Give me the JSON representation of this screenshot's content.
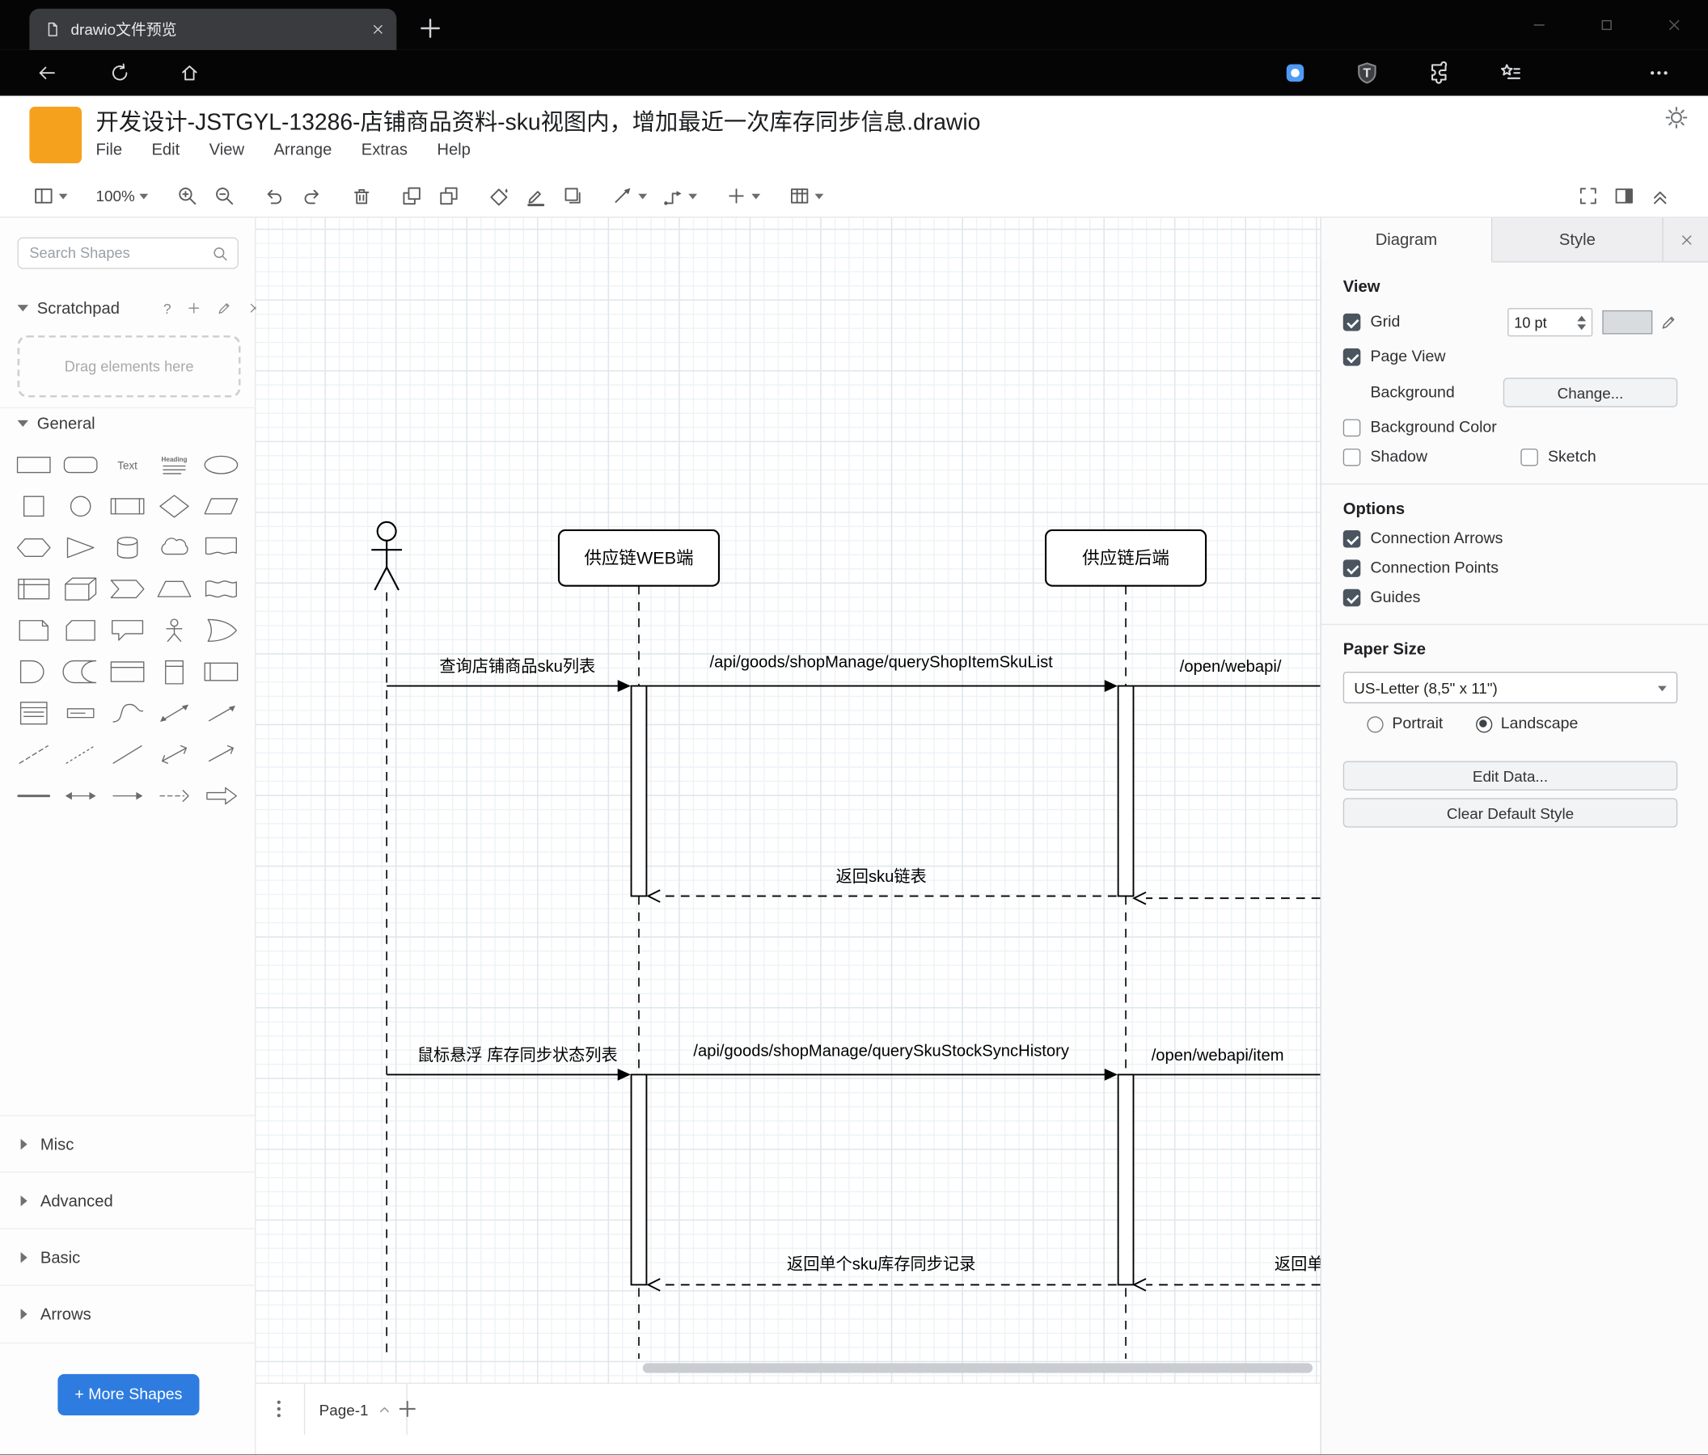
{
  "browser": {
    "tab_title": "drawio文件预览",
    "url": "https://file.kkview.cn/onlinePreview?url=aHR0cHM6Ly9maWxsLmtrV3hsTXRyZG1sbGR5NWpiaS4uLg"
  },
  "app": {
    "title": "开发设计-JSTGYL-13286-店铺商品资料-sku视图内，增加最近一次库存同步信息.drawio",
    "menus": [
      "File",
      "Edit",
      "View",
      "Arrange",
      "Extras",
      "Help"
    ],
    "zoom": "100%"
  },
  "sidebar": {
    "search_placeholder": "Search Shapes",
    "scratchpad_title": "Scratchpad",
    "scratchpad_help": "?",
    "scratchpad_hint": "Drag elements here",
    "sections": [
      "General",
      "Misc",
      "Advanced",
      "Basic",
      "Arrows"
    ],
    "more_shapes": "+ More Shapes",
    "shapes": [
      "rectangle",
      "rounded-rectangle",
      "text",
      "textbox",
      "ellipse",
      "square",
      "circle",
      "process",
      "diamond",
      "parallelogram",
      "hexagon",
      "triangle",
      "cylinder",
      "cloud",
      "document",
      "internal-storage",
      "cube",
      "step",
      "trapezoid",
      "tape",
      "note",
      "card",
      "callout",
      "actor",
      "or",
      "and",
      "data-storage",
      "container",
      "vertical-container",
      "horizontal-pool",
      "list",
      "list-item",
      "curve",
      "bidirectional-arrow",
      "arrow",
      "dashed-line",
      "dotted-line",
      "line",
      "bidirectional-connector",
      "directional-connector",
      "horizontal-line",
      "horizontal-double-arrow",
      "horizontal-arrow",
      "dashed-arrow",
      "block-arrow"
    ]
  },
  "canvas": {
    "page_tab": "Page-1"
  },
  "diagram": {
    "participants": [
      "供应链WEB端",
      "供应链后端"
    ],
    "messages": {
      "m1": "查询店铺商品sku列表",
      "m2": "/api/goods/shopManage/queryShopItemSkuList",
      "m3": "/open/webapi/",
      "r1": "返回sku链表",
      "m4": "鼠标悬浮 库存同步状态列表",
      "m5": "/api/goods/shopManage/querySkuStockSyncHistory",
      "m6": "/open/webapi/item",
      "r2": "返回单个sku库存同步记录",
      "r3": "返回单个sku库存同步记录"
    }
  },
  "panel": {
    "tabs": [
      "Diagram",
      "Style"
    ],
    "view": {
      "header": "View",
      "grid": "Grid",
      "grid_checked": true,
      "grid_size": "10 pt",
      "page_view": "Page View",
      "page_view_checked": true,
      "background": "Background",
      "change_button": "Change...",
      "background_color": "Background Color",
      "background_color_checked": false,
      "shadow": "Shadow",
      "shadow_checked": false,
      "sketch": "Sketch",
      "sketch_checked": false
    },
    "options": {
      "header": "Options",
      "items": [
        "Connection Arrows",
        "Connection Points",
        "Guides"
      ],
      "checked": [
        true,
        true,
        true
      ]
    },
    "paper": {
      "header": "Paper Size",
      "value": "US-Letter (8,5\" x 11\")",
      "portrait": "Portrait",
      "landscape": "Landscape",
      "orientation": "Landscape"
    },
    "edit_data": "Edit Data...",
    "clear_default_style": "Clear Default Style"
  }
}
